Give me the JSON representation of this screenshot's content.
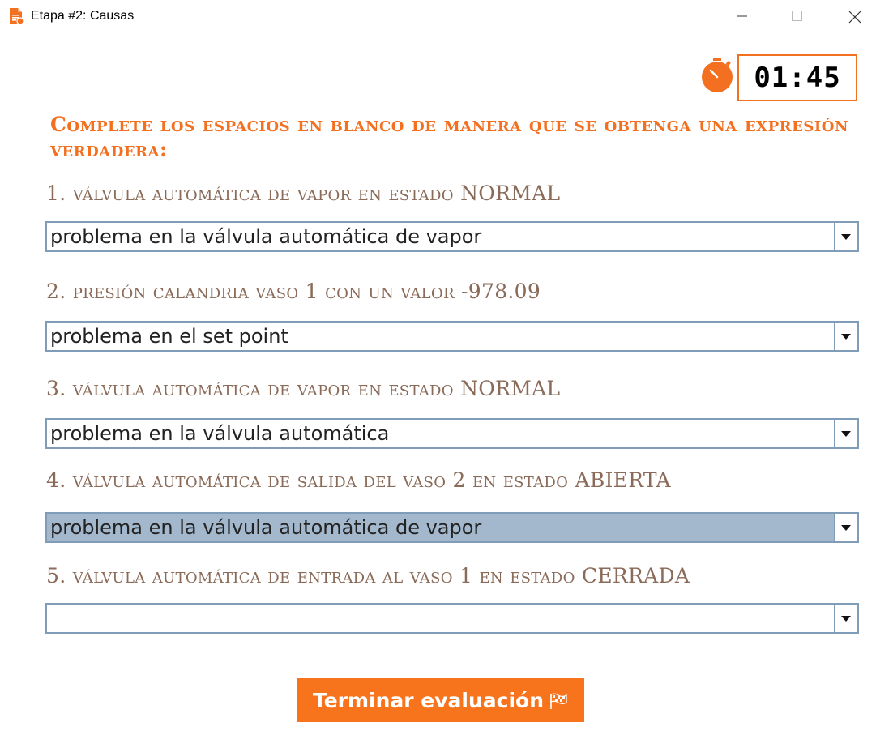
{
  "window": {
    "title": "Etapa #2: Causas"
  },
  "timer": {
    "value": "01:45"
  },
  "instructions": "Complete los espacios en blanco de manera que se obtenga una expresión verdadera:",
  "questions": [
    {
      "label": "1. válvula automática de vapor en estado NORMAL",
      "selected": "problema en la válvula automática de vapor"
    },
    {
      "label": "2. presión calandria vaso 1  con un valor -978.09",
      "selected": "problema en el set point"
    },
    {
      "label": "3. válvula automática de vapor en estado NORMAL",
      "selected": "problema en la válvula automática"
    },
    {
      "label": "4. válvula automática de salida del vaso 2 en estado ABIERTA",
      "selected": "problema en la válvula automática de vapor"
    },
    {
      "label": "5. válvula automática de entrada al vaso 1 en estado CERRADA",
      "selected": ""
    }
  ],
  "finish_button": {
    "label": "Terminar evaluación"
  },
  "colors": {
    "accent": "#f37021",
    "question_text": "#8a6a58",
    "combo_border": "#7f9db9",
    "combo_selected": "#a3b8cc"
  },
  "icons": [
    "document-app-icon",
    "minimize-icon",
    "maximize-icon",
    "close-icon",
    "stopwatch-icon",
    "chevron-down-icon",
    "checkered-flag-icon"
  ]
}
